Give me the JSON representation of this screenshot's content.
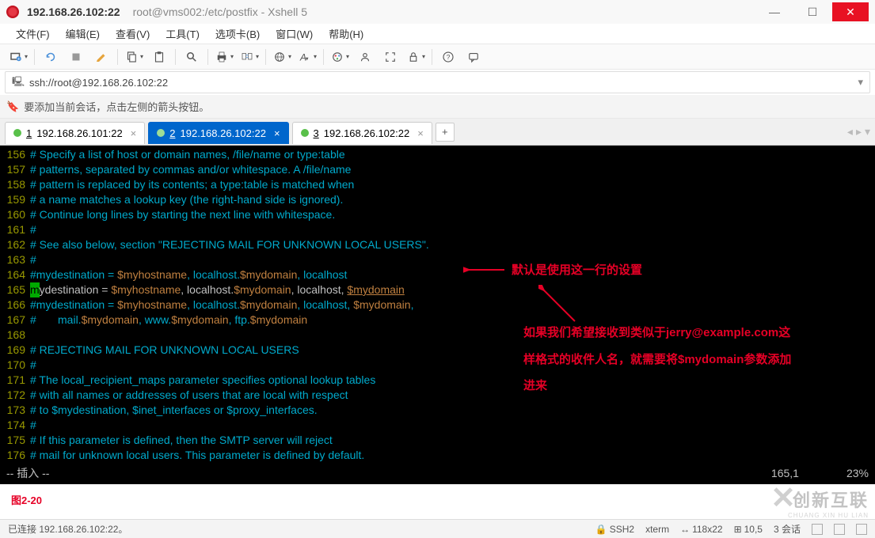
{
  "window": {
    "title_main": "192.168.26.102:22",
    "title_sub": "root@vms002:/etc/postfix - Xshell 5"
  },
  "menu": {
    "file": "文件(F)",
    "edit": "编辑(E)",
    "view": "查看(V)",
    "tools": "工具(T)",
    "tabs": "选项卡(B)",
    "window": "窗口(W)",
    "help": "帮助(H)"
  },
  "address": {
    "protocol_icon": "🖥",
    "text": "ssh://root@192.168.26.102:22"
  },
  "info_banner": "要添加当前会话，点击左侧的箭头按钮。",
  "tabs": [
    {
      "num": "1",
      "label": "192.168.26.101:22",
      "active": false
    },
    {
      "num": "2",
      "label": "192.168.26.102:22",
      "active": true
    },
    {
      "num": "3",
      "label": "192.168.26.102:22",
      "active": false
    }
  ],
  "editor": {
    "lines": [
      {
        "n": "156",
        "t": "# Specify a list of host or domain names, /file/name or type:table",
        "c": "comment"
      },
      {
        "n": "157",
        "t": "# patterns, separated by commas and/or whitespace. A /file/name",
        "c": "comment"
      },
      {
        "n": "158",
        "t": "# pattern is replaced by its contents; a type:table is matched when",
        "c": "comment"
      },
      {
        "n": "159",
        "t": "# a name matches a lookup key (the right-hand side is ignored).",
        "c": "comment"
      },
      {
        "n": "160",
        "t": "# Continue long lines by starting the next line with whitespace.",
        "c": "comment"
      },
      {
        "n": "161",
        "t": "#",
        "c": "comment"
      },
      {
        "n": "162",
        "t": "# See also below, section \"REJECTING MAIL FOR UNKNOWN LOCAL USERS\".",
        "c": "comment"
      },
      {
        "n": "163",
        "t": "#",
        "c": "comment"
      },
      {
        "n": "164",
        "segs": [
          {
            "t": "#mydestination = ",
            "c": "comment"
          },
          {
            "t": "$myhostname",
            "c": "var"
          },
          {
            "t": ", localhost.",
            "c": "comment"
          },
          {
            "t": "$mydomain",
            "c": "var"
          },
          {
            "t": ", localhost",
            "c": "comment"
          }
        ]
      },
      {
        "n": "165",
        "segs": [
          {
            "t": "m",
            "c": "cursor-bg"
          },
          {
            "t": "ydestination = ",
            "c": "plain"
          },
          {
            "t": "$myhostname",
            "c": "var"
          },
          {
            "t": ", localhost.",
            "c": "plain"
          },
          {
            "t": "$mydomain",
            "c": "var"
          },
          {
            "t": ", localhost, ",
            "c": "plain"
          },
          {
            "t": "$mydomain",
            "c": "var-underline"
          }
        ]
      },
      {
        "n": "166",
        "segs": [
          {
            "t": "#mydestination = ",
            "c": "comment"
          },
          {
            "t": "$myhostname",
            "c": "var"
          },
          {
            "t": ", localhost.",
            "c": "comment"
          },
          {
            "t": "$mydomain",
            "c": "var"
          },
          {
            "t": ", localhost, ",
            "c": "comment"
          },
          {
            "t": "$mydomain",
            "c": "var"
          },
          {
            "t": ",",
            "c": "comment"
          }
        ]
      },
      {
        "n": "167",
        "segs": [
          {
            "t": "#       mail.",
            "c": "comment"
          },
          {
            "t": "$mydomain",
            "c": "var"
          },
          {
            "t": ", www.",
            "c": "comment"
          },
          {
            "t": "$mydomain",
            "c": "var"
          },
          {
            "t": ", ftp.",
            "c": "comment"
          },
          {
            "t": "$mydomain",
            "c": "var"
          }
        ]
      },
      {
        "n": "168",
        "t": "",
        "c": "plain"
      },
      {
        "n": "169",
        "t": "# REJECTING MAIL FOR UNKNOWN LOCAL USERS",
        "c": "comment"
      },
      {
        "n": "170",
        "t": "#",
        "c": "comment"
      },
      {
        "n": "171",
        "t": "# The local_recipient_maps parameter specifies optional lookup tables",
        "c": "comment"
      },
      {
        "n": "172",
        "t": "# with all names or addresses of users that are local with respect",
        "c": "comment"
      },
      {
        "n": "173",
        "t": "# to $mydestination, $inet_interfaces or $proxy_interfaces.",
        "c": "comment"
      },
      {
        "n": "174",
        "t": "#",
        "c": "comment"
      },
      {
        "n": "175",
        "t": "# If this parameter is defined, then the SMTP server will reject",
        "c": "comment"
      },
      {
        "n": "176",
        "t": "# mail for unknown local users. This parameter is defined by default.",
        "c": "comment"
      }
    ],
    "mode": "-- 插入 --",
    "pos": "165,1",
    "percent": "23%"
  },
  "annotations": {
    "a1": "默认是使用这一行的设置",
    "a2_line1": "如果我们希望接收到类似于jerry@example.com这",
    "a2_line2": "样格式的收件人名，就需要将$mydomain参数添加",
    "a2_line3": "进来"
  },
  "figure_label": "图2-20",
  "status": {
    "connected": "已连接 192.168.26.102:22。",
    "ssh": "SSH2",
    "term": "xterm",
    "size": "118x22",
    "font": "10,5",
    "sessions": "3 会话"
  },
  "watermark": {
    "line1": "创新互联",
    "line2": "CHUANG XIN HU LIAN"
  }
}
